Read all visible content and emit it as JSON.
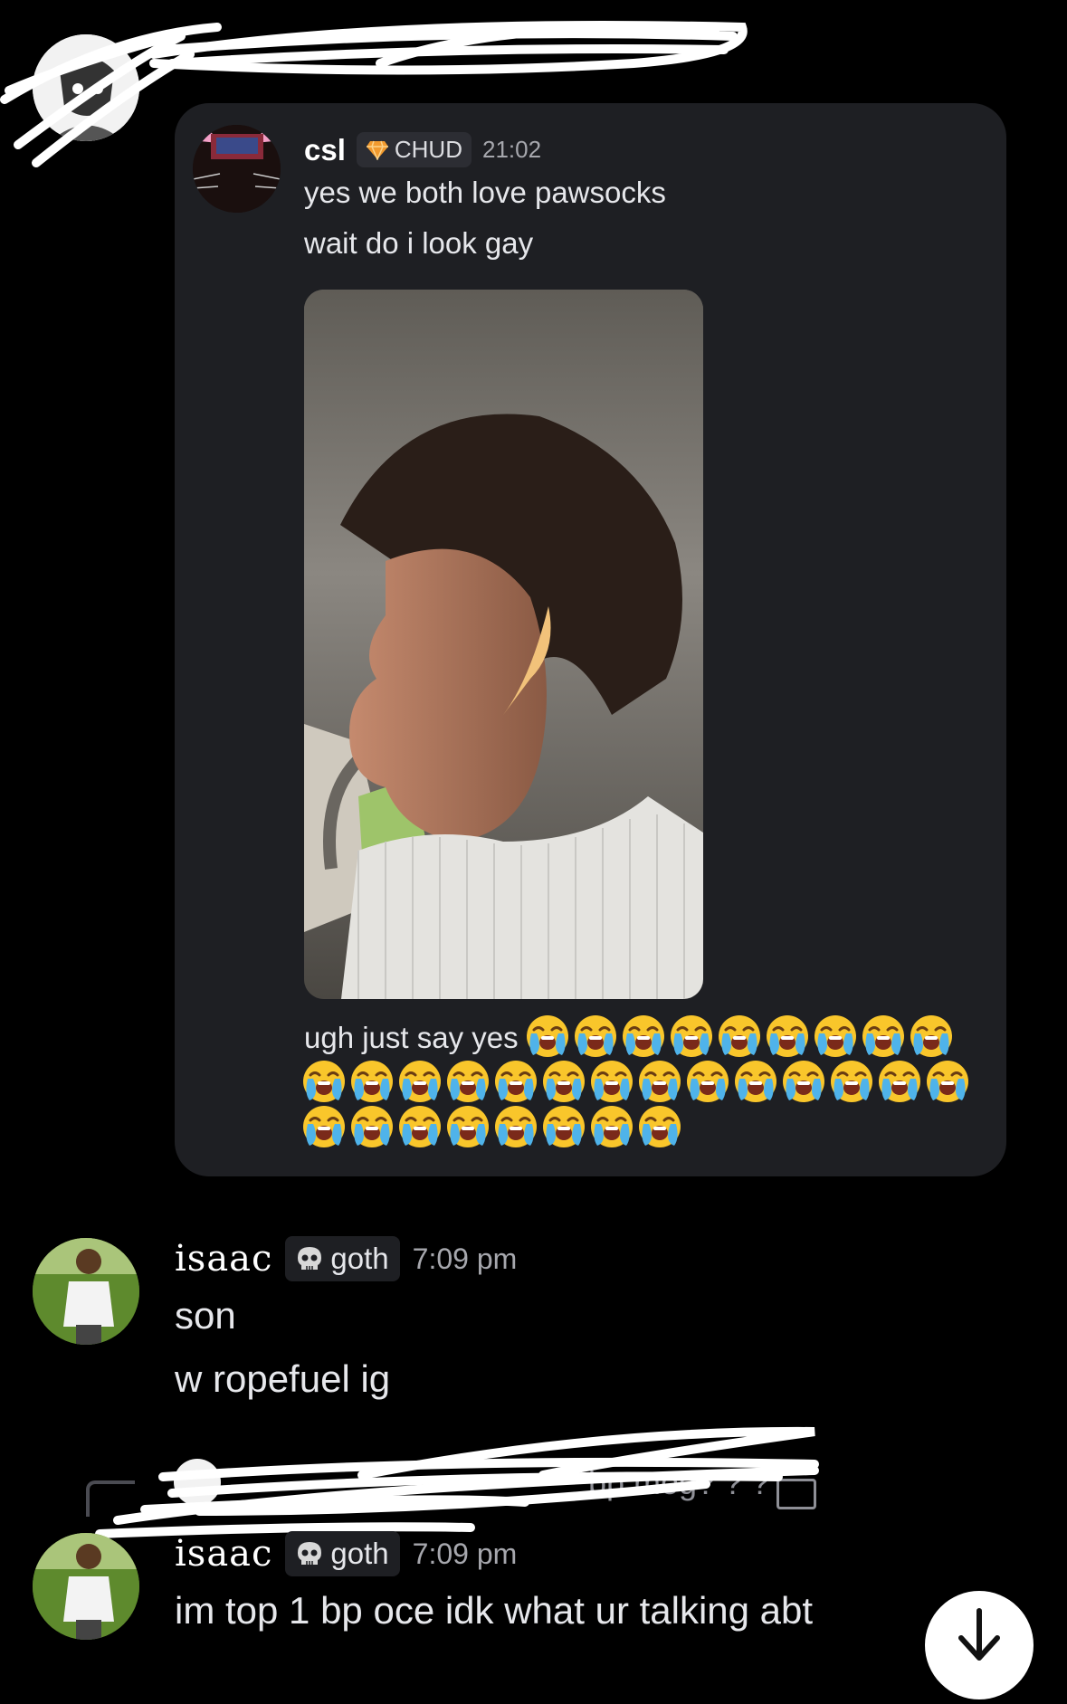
{
  "forwarded": {
    "username": "csl",
    "tag": "CHUD",
    "time": "21:02",
    "lines": [
      "yes we both love pawsocks",
      "wait do i look gay",
      "ugh just say yes"
    ],
    "emoji_name": "loudly-crying-face"
  },
  "messages": [
    {
      "username": "isaac",
      "tag": "goth",
      "time": "7:09 pm",
      "lines": [
        "son",
        "w ropefuel ig"
      ]
    },
    {
      "username": "isaac",
      "tag": "goth",
      "time": "7:09 pm",
      "lines": [
        "im top 1 bp oce idk what ur talking abt"
      ]
    }
  ],
  "reply_preview": {
    "text": "bp mog? ? ?"
  },
  "colors": {
    "card": "#1e1f23",
    "muted": "#a6a7ad",
    "tag_bg": "#2c2d33"
  }
}
